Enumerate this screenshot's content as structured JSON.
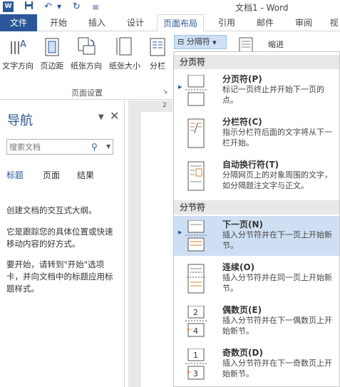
{
  "window": {
    "title": "文档1 - Word"
  },
  "tabs": [
    "文件",
    "开始",
    "插入",
    "设计",
    "页面布局",
    "引用",
    "邮件",
    "审阅",
    "视"
  ],
  "ribbon": {
    "buttons": [
      "文字方向",
      "页边距",
      "纸张方向",
      "纸张大小",
      "分栏"
    ],
    "group_label": "页面设置",
    "breaks_button": "分隔符",
    "indent_label": "缩进"
  },
  "nav": {
    "title": "导航",
    "search_placeholder": "搜索文档",
    "tabs": [
      "标题",
      "页面",
      "结果"
    ],
    "text1": "创建文档的交互式大纲。",
    "text2": "它是跟踪您的具体位置或快速移动内容的好方式。",
    "text3": "要开始，请转到\"开始\"选项卡，并向文档中的标题应用标题样式。"
  },
  "ruler": {
    "mark": "2"
  },
  "menu": {
    "section1": "分页符",
    "section2": "分节符",
    "items": [
      {
        "title": "分页符(P)",
        "desc": "标记一页终止并开始下一页的点。"
      },
      {
        "title": "分栏符(C)",
        "desc": "指示分栏符后面的文字将从下一栏开始。"
      },
      {
        "title": "自动换行符(T)",
        "desc": "分隔网页上的对象周围的文字，如分隔题注文字与正文。"
      },
      {
        "title": "下一页(N)",
        "desc": "插入分节符并在下一页上开始新节。"
      },
      {
        "title": "连续(O)",
        "desc": "插入分节符并在同一页上开始新节。"
      },
      {
        "title": "偶数页(E)",
        "desc": "插入分节符并在下一偶数页上开始新节。"
      },
      {
        "title": "奇数页(D)",
        "desc": "插入分节符并在下一奇数页上开始新节。"
      }
    ]
  },
  "colors": {
    "accent": "#2b579a",
    "highlight": "#cfdff3"
  }
}
